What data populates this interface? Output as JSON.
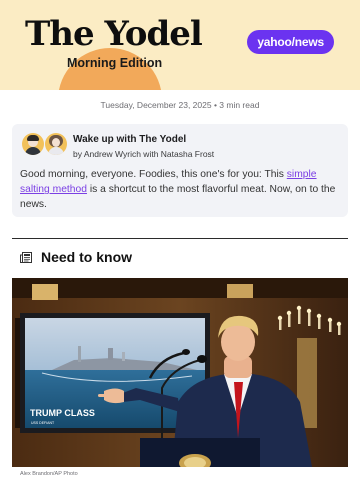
{
  "masthead": {
    "title": "The Yodel",
    "subtitle": "Morning Edition",
    "brand_logo": "yahoo/news",
    "colors": {
      "background": "#fbecc4",
      "sun": "#f2a95a",
      "brand_purple": "#6b33f0"
    }
  },
  "dateline": "Tuesday, December 23, 2025 • 3 min read",
  "welcome": {
    "title": "Wake up with The Yodel",
    "byline": "by Andrew Wyrich with Natasha Frost",
    "body_before_link": "Good morning, everyone. Foodies, this one's for you: This ",
    "link_text": "simple salting method",
    "body_after_link": " is a shortcut to the most flavorful meat. Now, on to the news.",
    "avatars": [
      "author-avatar-andrew",
      "author-avatar-natasha"
    ]
  },
  "section": {
    "icon": "newspaper-icon",
    "title": "Need to know"
  },
  "photo": {
    "subject": "news-photo",
    "sign_text_1": "TRUMP CLASS",
    "sign_text_2": "USS DEFIANT",
    "credit": "Alex Brandon/AP Photo"
  }
}
